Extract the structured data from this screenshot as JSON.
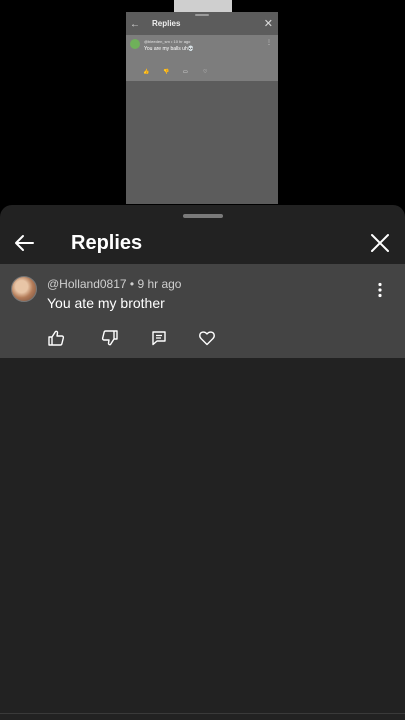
{
  "background": {
    "title": "Replies",
    "comment": {
      "meta": "@bleeden_sm • 10 hr ago",
      "text": "You are my balls uh💀"
    }
  },
  "sheet": {
    "title": "Replies",
    "comment": {
      "author": "@Holland0817",
      "time": "9 hr ago",
      "meta": "@Holland0817 • 9 hr ago",
      "text": "You ate my brother"
    },
    "actions": [
      "like-icon",
      "dislike-icon",
      "reply-icon",
      "heart-icon"
    ]
  },
  "colors": {
    "sheet_bg": "#222222",
    "comment_bg": "#444444",
    "text_primary": "#ffffff",
    "text_secondary": "#cfcfcf"
  }
}
